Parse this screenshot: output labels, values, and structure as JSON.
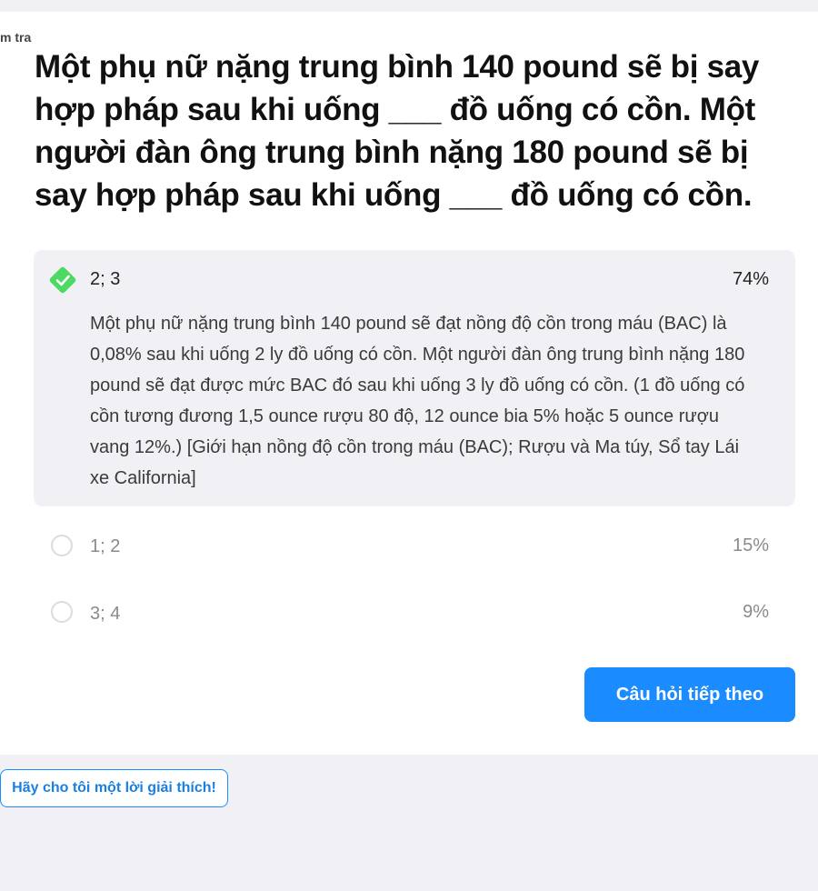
{
  "header": {
    "kicker": "m tra"
  },
  "question": {
    "text": "Một phụ nữ nặng trung bình 140 pound sẽ bị say hợp pháp sau khi uống ___ đồ uống có cồn. Một người đàn ông trung bình nặng 180 pound sẽ bị say hợp pháp sau khi uống ___ đồ uống có cồn."
  },
  "answers": [
    {
      "label": "2; 3",
      "percent": "74%",
      "correct": true,
      "explanation": "Một phụ nữ nặng trung bình 140 pound sẽ đạt nồng độ cồn trong máu (BAC) là 0,08% sau khi uống 2 ly đồ uống có cồn. Một người đàn ông trung bình nặng 180 pound sẽ đạt được mức BAC đó sau khi uống 3 ly đồ uống có cồn. (1 đồ uống có cồn tương đương 1,5 ounce rượu 80 độ, 12 ounce bia 5% hoặc 5 ounce rượu vang 12%.) [Giới hạn nồng độ cồn trong máu (BAC); Rượu và Ma túy, Sổ tay Lái xe California]"
    },
    {
      "label": "1; 2",
      "percent": "15%",
      "correct": false
    },
    {
      "label": "3; 4",
      "percent": "9%",
      "correct": false
    }
  ],
  "buttons": {
    "next": "Câu hỏi tiếp theo",
    "explain": "Hãy cho tôi một lời giải thích!"
  },
  "colors": {
    "accent": "#1a8cff",
    "check": "#4cd964",
    "selected_bg": "#f0f0f5",
    "page_bg": "#f0f0f5"
  },
  "icons": {
    "correct": "check-diamond-icon",
    "unselected": "radio-circle-icon"
  }
}
